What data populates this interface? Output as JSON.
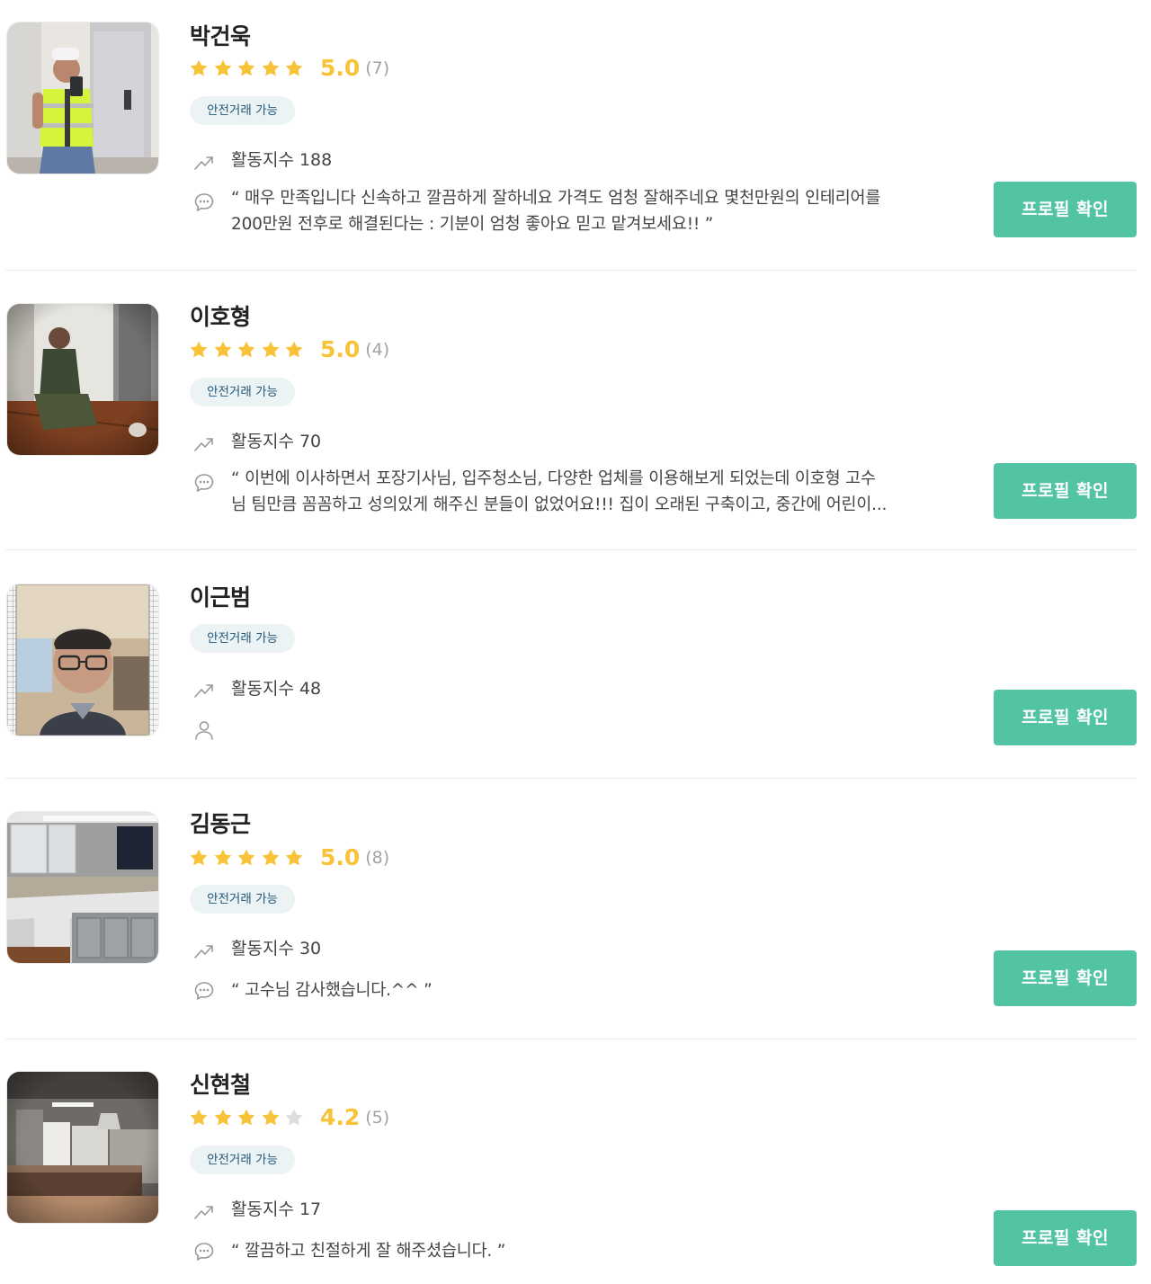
{
  "colors": {
    "star_filled": "#f8c339",
    "star_empty": "#dddddd",
    "score": "#f8c339",
    "badge_bg": "#ecf3f5",
    "badge_text": "#22587a",
    "button_bg": "#52c3a3",
    "button_text": "#ffffff",
    "divider": "#ececec"
  },
  "icons": {
    "activity": "trending-up-icon",
    "review": "speech-bubble-icon",
    "no_review": "person-icon",
    "star": "star-icon"
  },
  "experts": [
    {
      "name": "박건욱",
      "rating": {
        "score": "5.0",
        "count": "(7)",
        "stars": 5
      },
      "badge": "안전거래 가능",
      "activity": "활동지수 188",
      "review": [
        "“ 매우 만족입니다 신속하고 깔끔하게 잘하네요 가격도 엄청 잘해주네요 몇천만원의 인테리어를",
        "200만원 전후로 해결된다는 :  기분이 엄청 좋아요 믿고 맡겨보세요!! ”"
      ],
      "button": "프로필 확인"
    },
    {
      "name": "이호형",
      "rating": {
        "score": "5.0",
        "count": "(4)",
        "stars": 5
      },
      "badge": "안전거래 가능",
      "activity": "활동지수 70",
      "review": [
        "“ 이번에 이사하면서 포장기사님, 입주청소님, 다양한 업체를 이용해보게 되었는데 이호형 고수",
        "님 팀만큼 꼼꼼하고 성의있게 해주신 분들이 없었어요!!! 집이 오래된 구축이고, 중간에 어린이..."
      ],
      "button": "프로필 확인"
    },
    {
      "name": "이근범",
      "badge": "안전거래 가능",
      "activity": "활동지수 48",
      "button": "프로필 확인"
    },
    {
      "name": "김동근",
      "rating": {
        "score": "5.0",
        "count": "(8)",
        "stars": 5
      },
      "badge": "안전거래 가능",
      "activity": "활동지수 30",
      "review": [
        "“ 고수님 감사했습니다.^^ ”"
      ],
      "button": "프로필 확인"
    },
    {
      "name": "신현철",
      "rating": {
        "score": "4.2",
        "count": "(5)",
        "stars": 4.2
      },
      "badge": "안전거래 가능",
      "activity": "활동지수 17",
      "review": [
        "“ 깔끔하고 친절하게 잘 해주셨습니다. ”"
      ],
      "button": "프로필 확인"
    }
  ]
}
